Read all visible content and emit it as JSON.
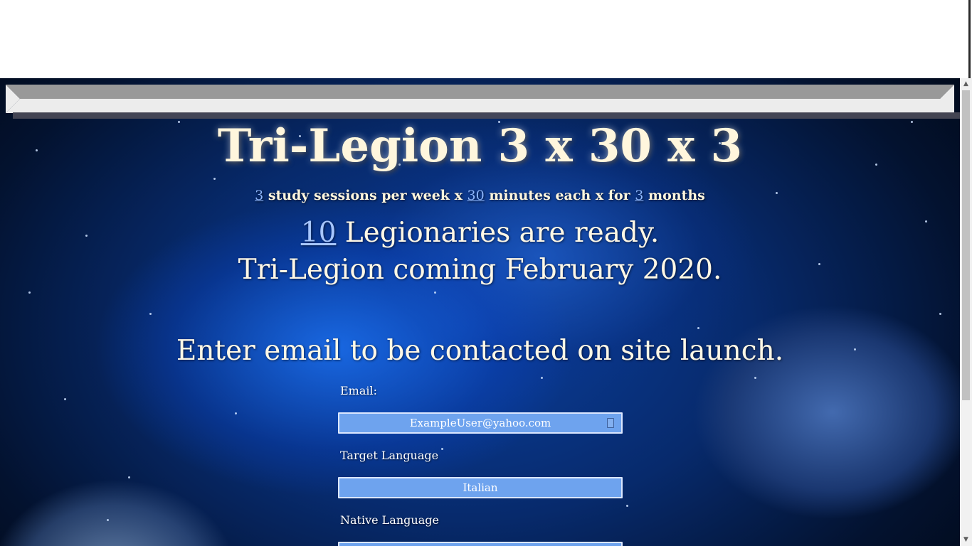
{
  "hero": {
    "title": "Tri-Legion 3 x 30 x 3",
    "subtitle_num1": "3",
    "subtitle_text1": " study sessions per week x ",
    "subtitle_num2": "30",
    "subtitle_text2": " minutes each x for ",
    "subtitle_num3": "3",
    "subtitle_text3": " months",
    "ready_count": "10",
    "ready_text": " Legionaries are ready.",
    "coming_text": "Tri-Legion coming February 2020.",
    "enter_text": "Enter email to be contacted on site launch."
  },
  "form": {
    "email_label": "Email:",
    "email_value": "ExampleUser@yahoo.com",
    "target_label": "Target Language",
    "target_value": "Italian",
    "native_label": "Native Language",
    "native_value": ""
  },
  "icons": {
    "autofill": "autofill-key-icon",
    "scroll_up": "scroll-up-arrow-icon",
    "scroll_down": "scroll-down-arrow-icon"
  },
  "colors": {
    "title_text": "#fff6dd",
    "link_numbers": "#8fb8ff",
    "field_background": "#6ea3ee",
    "nav_bar_dark": "#999999",
    "nav_bar_light": "#ececec"
  }
}
